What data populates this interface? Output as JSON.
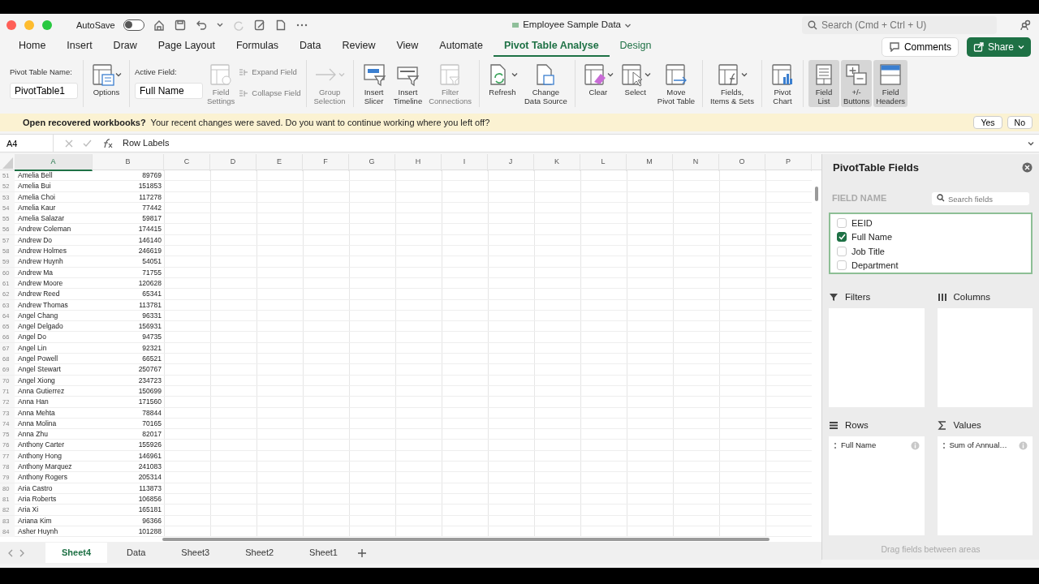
{
  "window": {
    "title": "Employee Sample Data",
    "autosave": {
      "label": "AutoSave",
      "on": false
    },
    "search_placeholder": "Search (Cmd + Ctrl + U)"
  },
  "menu_tabs": [
    {
      "label": "Home",
      "selected": false
    },
    {
      "label": "Insert",
      "selected": false
    },
    {
      "label": "Draw",
      "selected": false
    },
    {
      "label": "Page Layout",
      "selected": false
    },
    {
      "label": "Formulas",
      "selected": false
    },
    {
      "label": "Data",
      "selected": false
    },
    {
      "label": "Review",
      "selected": false
    },
    {
      "label": "View",
      "selected": false
    },
    {
      "label": "Automate",
      "selected": false
    },
    {
      "label": "Pivot Table Analyse",
      "selected": true
    },
    {
      "label": "Design",
      "selected": false
    }
  ],
  "comments_button": "Comments",
  "share_button": "Share",
  "ribbon_groups": [
    {
      "items": [
        {
          "kind": "field",
          "label": "Pivot Table Name:",
          "value": "PivotTable1"
        }
      ]
    },
    {
      "items": [
        {
          "kind": "large",
          "label": "Options",
          "dropdown": true,
          "disabled": false,
          "pressed": false
        }
      ]
    },
    {
      "items": [
        {
          "kind": "field",
          "label": "Active Field:",
          "value": "Full Name"
        },
        {
          "kind": "large",
          "label": "Field\nSettings",
          "dropdown": false,
          "disabled": true,
          "pressed": false
        },
        {
          "kind": "small",
          "label": "Expand Field",
          "disabled": true
        },
        {
          "kind": "small",
          "label": "Collapse Field",
          "disabled": true
        }
      ]
    },
    {
      "items": [
        {
          "kind": "large",
          "label": "Group\nSelection",
          "dropdown": true,
          "disabled": true,
          "pressed": false
        }
      ]
    },
    {
      "items": [
        {
          "kind": "large",
          "label": "Insert\nSlicer",
          "dropdown": false,
          "disabled": false,
          "pressed": false
        },
        {
          "kind": "large",
          "label": "Insert\nTimeline",
          "dropdown": false,
          "disabled": false,
          "pressed": false
        },
        {
          "kind": "large",
          "label": "Filter\nConnections",
          "dropdown": false,
          "disabled": true,
          "pressed": false
        }
      ]
    },
    {
      "items": [
        {
          "kind": "large",
          "label": "Refresh",
          "dropdown": true,
          "disabled": false,
          "pressed": false
        },
        {
          "kind": "large",
          "label": "Change\nData Source",
          "dropdown": false,
          "disabled": false,
          "pressed": false
        }
      ]
    },
    {
      "items": [
        {
          "kind": "large",
          "label": "Clear",
          "dropdown": true,
          "disabled": false,
          "pressed": false
        },
        {
          "kind": "large",
          "label": "Select",
          "dropdown": true,
          "disabled": false,
          "pressed": false
        },
        {
          "kind": "large",
          "label": "Move\nPivot Table",
          "dropdown": false,
          "disabled": false,
          "pressed": false
        }
      ]
    },
    {
      "items": [
        {
          "kind": "large",
          "label": "Fields,\nItems & Sets",
          "dropdown": true,
          "disabled": false,
          "pressed": false
        }
      ]
    },
    {
      "items": [
        {
          "kind": "large",
          "label": "Pivot\nChart",
          "dropdown": false,
          "disabled": false,
          "pressed": false
        }
      ]
    },
    {
      "items": [
        {
          "kind": "large",
          "label": "Field\nList",
          "dropdown": false,
          "disabled": false,
          "pressed": true
        },
        {
          "kind": "large",
          "label": "+/-\nButtons",
          "dropdown": false,
          "disabled": false,
          "pressed": true
        },
        {
          "kind": "large",
          "label": "Field\nHeaders",
          "dropdown": false,
          "disabled": false,
          "pressed": true
        }
      ]
    }
  ],
  "message_bar": {
    "title": "Open recovered workbooks?",
    "message": "Your recent changes were saved. Do you want to continue working where you left off?",
    "buttons": [
      "Yes",
      "No"
    ]
  },
  "formula_bar": {
    "name_box": "A4",
    "formula": "Row Labels"
  },
  "columns": [
    {
      "label": "A",
      "selected": true
    },
    {
      "label": "B",
      "selected": false
    },
    {
      "label": "C",
      "selected": false
    },
    {
      "label": "D",
      "selected": false
    },
    {
      "label": "E",
      "selected": false
    },
    {
      "label": "F",
      "selected": false
    },
    {
      "label": "G",
      "selected": false
    },
    {
      "label": "H",
      "selected": false
    },
    {
      "label": "I",
      "selected": false
    },
    {
      "label": "J",
      "selected": false
    },
    {
      "label": "K",
      "selected": false
    },
    {
      "label": "L",
      "selected": false
    },
    {
      "label": "M",
      "selected": false
    },
    {
      "label": "N",
      "selected": false
    },
    {
      "label": "O",
      "selected": false
    },
    {
      "label": "P",
      "selected": false
    }
  ],
  "rows": [
    {
      "row": "51",
      "name": "Amelia Bell",
      "value": "89769"
    },
    {
      "row": "52",
      "name": "Amelia Bui",
      "value": "151853"
    },
    {
      "row": "53",
      "name": "Amelia Choi",
      "value": "117278"
    },
    {
      "row": "54",
      "name": "Amelia Kaur",
      "value": "77442"
    },
    {
      "row": "55",
      "name": "Amelia Salazar",
      "value": "59817"
    },
    {
      "row": "56",
      "name": "Andrew Coleman",
      "value": "174415"
    },
    {
      "row": "57",
      "name": "Andrew Do",
      "value": "146140"
    },
    {
      "row": "58",
      "name": "Andrew Holmes",
      "value": "246619"
    },
    {
      "row": "59",
      "name": "Andrew Huynh",
      "value": "54051"
    },
    {
      "row": "60",
      "name": "Andrew Ma",
      "value": "71755"
    },
    {
      "row": "61",
      "name": "Andrew Moore",
      "value": "120628"
    },
    {
      "row": "62",
      "name": "Andrew Reed",
      "value": "65341"
    },
    {
      "row": "63",
      "name": "Andrew Thomas",
      "value": "113781"
    },
    {
      "row": "64",
      "name": "Angel Chang",
      "value": "96331"
    },
    {
      "row": "65",
      "name": "Angel Delgado",
      "value": "156931"
    },
    {
      "row": "66",
      "name": "Angel Do",
      "value": "94735"
    },
    {
      "row": "67",
      "name": "Angel Lin",
      "value": "92321"
    },
    {
      "row": "68",
      "name": "Angel Powell",
      "value": "66521"
    },
    {
      "row": "69",
      "name": "Angel Stewart",
      "value": "250767"
    },
    {
      "row": "70",
      "name": "Angel Xiong",
      "value": "234723"
    },
    {
      "row": "71",
      "name": "Anna Gutierrez",
      "value": "150699"
    },
    {
      "row": "72",
      "name": "Anna Han",
      "value": "171560"
    },
    {
      "row": "73",
      "name": "Anna Mehta",
      "value": "78844"
    },
    {
      "row": "74",
      "name": "Anna Molina",
      "value": "70165"
    },
    {
      "row": "75",
      "name": "Anna Zhu",
      "value": "82017"
    },
    {
      "row": "76",
      "name": "Anthony Carter",
      "value": "155926"
    },
    {
      "row": "77",
      "name": "Anthony Hong",
      "value": "146961"
    },
    {
      "row": "78",
      "name": "Anthony Marquez",
      "value": "241083"
    },
    {
      "row": "79",
      "name": "Anthony Rogers",
      "value": "205314"
    },
    {
      "row": "80",
      "name": "Aria Castro",
      "value": "113873"
    },
    {
      "row": "81",
      "name": "Aria Roberts",
      "value": "106856"
    },
    {
      "row": "82",
      "name": "Aria Xi",
      "value": "165181"
    },
    {
      "row": "83",
      "name": "Ariana Kim",
      "value": "96366"
    },
    {
      "row": "84",
      "name": "Asher Huynh",
      "value": "101288"
    }
  ],
  "pivot_panel": {
    "title": "PivotTable Fields",
    "field_name_label": "FIELD NAME",
    "search_placeholder": "Search fields",
    "fields": [
      {
        "label": "EEID",
        "checked": false
      },
      {
        "label": "Full Name",
        "checked": true
      },
      {
        "label": "Job Title",
        "checked": false
      },
      {
        "label": "Department",
        "checked": false
      }
    ],
    "areas": [
      {
        "kind": "filters",
        "label": "Filters"
      },
      {
        "kind": "columns",
        "label": "Columns"
      },
      {
        "kind": "rows",
        "label": "Rows",
        "items": [
          "Full Name"
        ]
      },
      {
        "kind": "values",
        "label": "Values",
        "items": [
          "Sum of Annual…"
        ]
      }
    ],
    "hint": "Drag fields between areas"
  },
  "sheet_tabs": [
    {
      "label": "Sheet4",
      "selected": true
    },
    {
      "label": "Data",
      "selected": false
    },
    {
      "label": "Sheet3",
      "selected": false
    },
    {
      "label": "Sheet2",
      "selected": false
    },
    {
      "label": "Sheet1",
      "selected": false
    }
  ]
}
